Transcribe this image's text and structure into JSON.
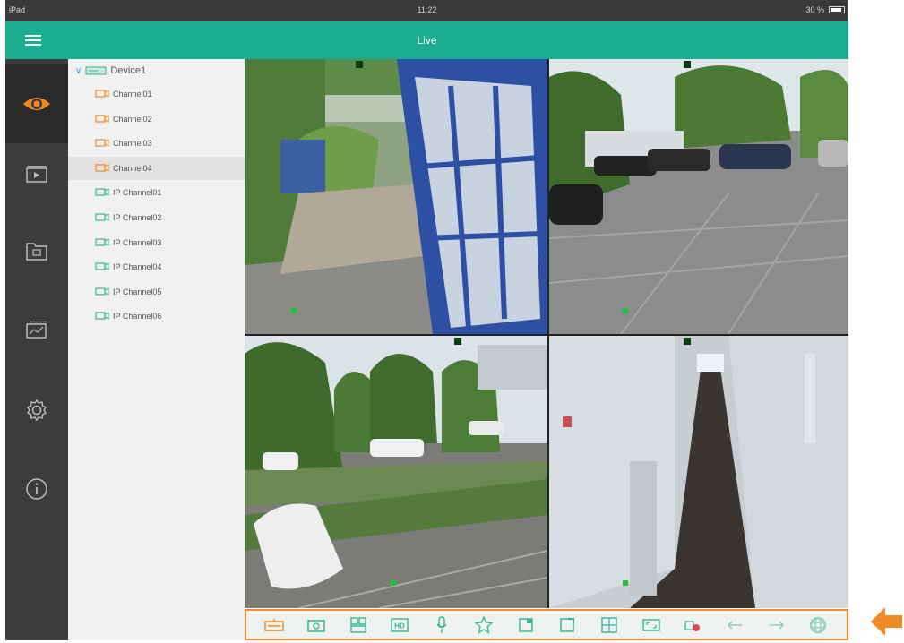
{
  "status_bar": {
    "carrier": "iPad",
    "time": "11:22",
    "battery": "30 %"
  },
  "header": {
    "title": "Live"
  },
  "sidebar": {
    "items": [
      {
        "icon": "eye-icon",
        "active": true
      },
      {
        "icon": "playback-icon",
        "active": false
      },
      {
        "icon": "folder-icon",
        "active": false
      },
      {
        "icon": "picture-icon",
        "active": false
      },
      {
        "icon": "gear-icon",
        "active": false
      },
      {
        "icon": "info-icon",
        "active": false
      }
    ]
  },
  "device_tree": {
    "device": "Device1",
    "channels": [
      {
        "label": "Channel01",
        "type": "analog",
        "selected": false
      },
      {
        "label": "Channel02",
        "type": "analog",
        "selected": false
      },
      {
        "label": "Channel03",
        "type": "analog",
        "selected": false
      },
      {
        "label": "Channel04",
        "type": "analog",
        "selected": true
      },
      {
        "label": "IP Channel01",
        "type": "ip",
        "selected": false
      },
      {
        "label": "IP Channel02",
        "type": "ip",
        "selected": false
      },
      {
        "label": "IP Channel03",
        "type": "ip",
        "selected": false
      },
      {
        "label": "IP Channel04",
        "type": "ip",
        "selected": false
      },
      {
        "label": "IP Channel05",
        "type": "ip",
        "selected": false
      },
      {
        "label": "IP Channel06",
        "type": "ip",
        "selected": false
      }
    ]
  },
  "live_view": {
    "tiles": [
      {
        "osd": "",
        "scene": "entrance"
      },
      {
        "osd": "",
        "scene": "parking"
      },
      {
        "osd": "",
        "scene": "lot"
      },
      {
        "osd": "",
        "scene": "corridor"
      }
    ]
  },
  "toolbar": {
    "tools": [
      "stream-icon",
      "snapshot-icon",
      "layout-icon",
      "hd-icon",
      "microphone-icon",
      "favorite-star-icon",
      "single-view-icon",
      "fullscreen-icon",
      "grid-view-icon",
      "aspect-ratio-icon",
      "record-stop-icon",
      "arrow-left-icon",
      "arrow-right-icon",
      "ptz-icon"
    ]
  },
  "colors": {
    "accent": "#1cac90",
    "icon_orange": "#f08a26",
    "ip_green": "#31b794",
    "sidebar": "#3c3c3c",
    "highlight_border": "#f08a26"
  }
}
